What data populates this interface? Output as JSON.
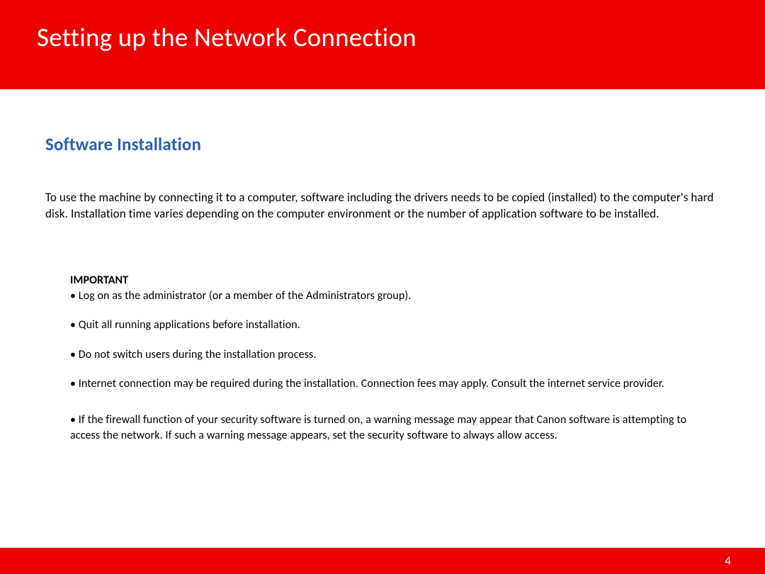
{
  "header": {
    "title": "Setting up the Network Connection"
  },
  "section": {
    "heading": "Software Installation",
    "intro": "To use the machine by connecting it to a computer, software including the drivers needs to be copied (installed) to the computer's hard disk. Installation time varies depending on the computer environment or the number of application software to be installed."
  },
  "important": {
    "label": "IMPORTANT",
    "items": [
      "• Log on as the administrator (or a member of the Administrators group).",
      "• Quit all running applications before installation.",
      "• Do not switch users during the installation process.",
      "• Internet connection may be required during the installation. Connection fees may apply. Consult the internet service provider.",
      "• If the firewall function of your security software is turned on, a warning message may appear that Canon software is attempting to access the network. If such a warning message appears, set the security software to always allow access."
    ]
  },
  "footer": {
    "page_number": "4"
  }
}
